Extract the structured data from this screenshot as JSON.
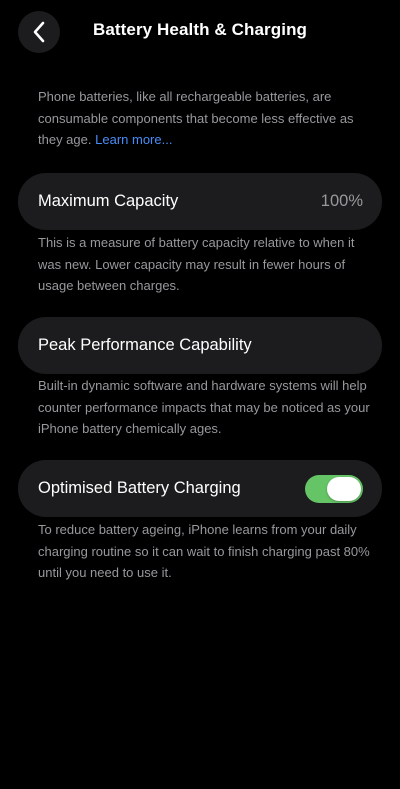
{
  "nav": {
    "title": "Battery Health & Charging",
    "back_icon": "chevron-left-icon"
  },
  "intro": {
    "text": "Phone batteries, like all rechargeable batteries, are consumable components that become less effective as they age.",
    "link_label": "Learn more..."
  },
  "maximum_capacity": {
    "label": "Maximum Capacity",
    "value": "100%",
    "footnote": "This is a measure of battery capacity relative to when it was new. Lower capacity may result in fewer hours of usage between charges."
  },
  "peak_performance": {
    "label": "Peak Performance Capability",
    "footnote": "Built-in dynamic software and hardware systems will help counter performance impacts that may be noticed as your iPhone battery chemically ages."
  },
  "optimised_charging": {
    "label": "Optimised Battery Charging",
    "enabled": true,
    "footnote": "To reduce battery ageing, iPhone learns from your daily charging routine so it can wait to finish charging past 80% until you need to use it."
  },
  "colors": {
    "background": "#000000",
    "cell": "#1c1c1e",
    "secondary_text": "#98989d",
    "link": "#4a8cf7",
    "toggle_on": "#65c466"
  }
}
